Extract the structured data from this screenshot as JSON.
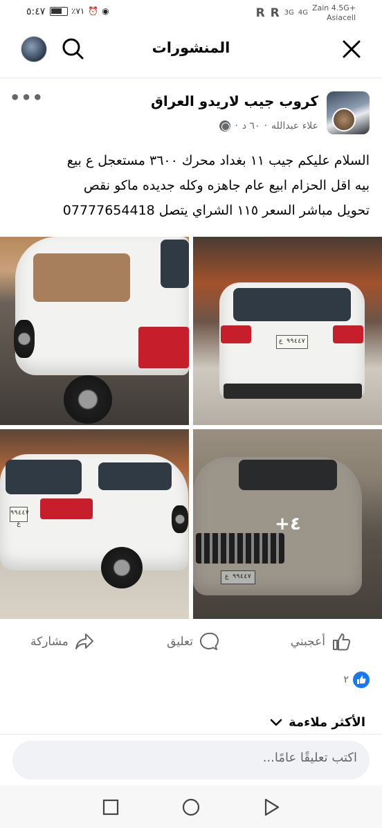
{
  "status_bar": {
    "time": "٥:٤٧",
    "battery": "٪٧١",
    "network_labels": "R R",
    "signal_a": "3G",
    "signal_b": "4G",
    "carrier_line1": "Zain 4.5G+",
    "carrier_line2": "Asiacell"
  },
  "header": {
    "title": "المنشورات"
  },
  "post": {
    "group_name": "كروب جيب لاريدو العراق",
    "author": "علاء عبدالله",
    "time_ago": "٦٠ د",
    "text_lines": [
      "السلام عليكم جيب ١١ بغداد محرك ٣٦٠٠ مستعجل ع بيع",
      "بيه اقل الحزام  ابيع عام جاهزه وكله جديده ماكو نقص",
      "تحويل مباشر السعر ١١٥ الشراي يتصل 07777654418"
    ],
    "photos_more": "+٤",
    "plate_texts": [
      "٩٩٤٤٧ ع",
      "٩٩٤٤٧ ع",
      "٩٩٤٤٧ ع"
    ]
  },
  "actions": {
    "like": "أعجبني",
    "comment": "تعليق",
    "share": "مشاركة"
  },
  "reactions": {
    "count": "٢"
  },
  "sort": {
    "label": "الأكثر ملاءمة"
  },
  "comment_input": {
    "placeholder": "اكتب تعليقًا عامًا..."
  },
  "colors": {
    "accent": "#1877f2",
    "muted_text": "#65676b",
    "input_bg": "#f0f2f5"
  },
  "icons": [
    "search-icon",
    "close-icon",
    "more-icon",
    "globe-icon",
    "like-icon",
    "comment-icon",
    "share-icon",
    "chevron-down-icon",
    "nav-recent-icon",
    "nav-home-icon",
    "nav-back-icon"
  ]
}
